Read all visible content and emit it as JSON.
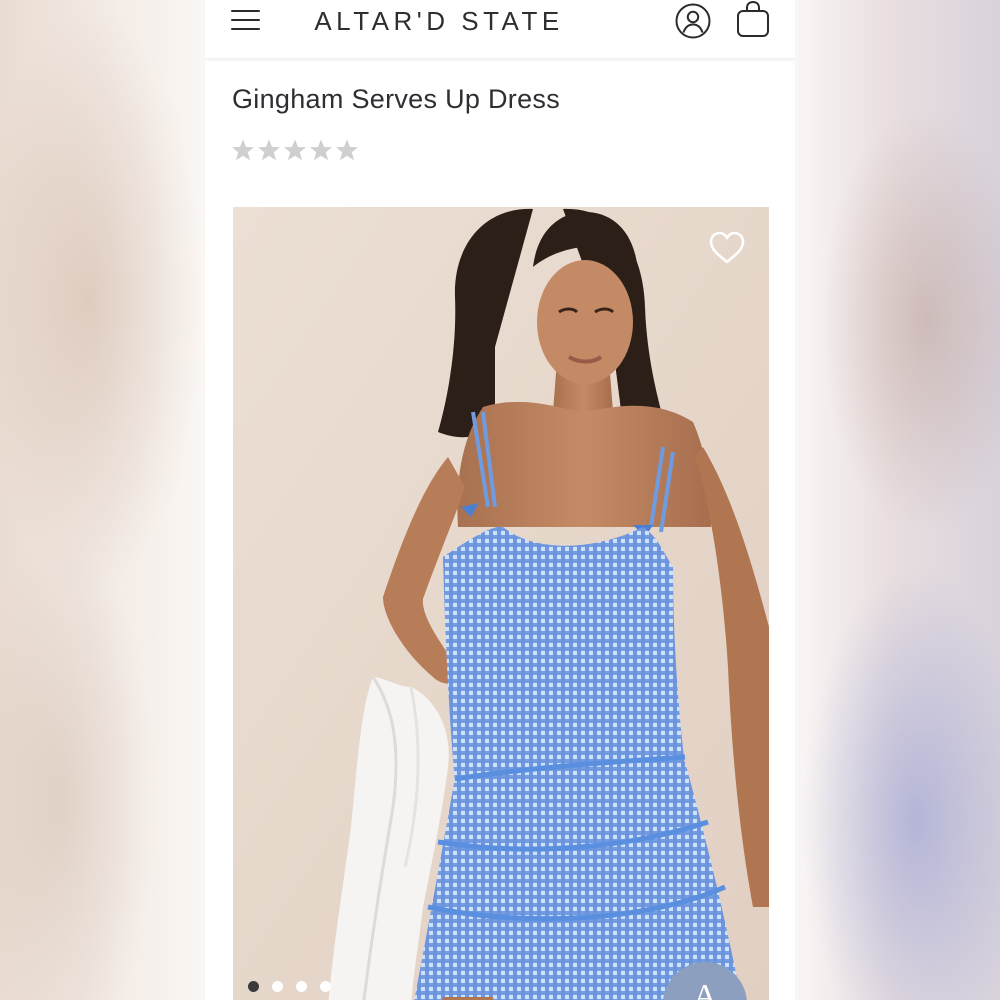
{
  "header": {
    "brand": "ALTAR'D STATE",
    "menu_icon": "hamburger-menu-icon",
    "account_icon": "user-account-icon",
    "bag_icon": "shopping-bag-icon"
  },
  "product": {
    "title": "Gingham Serves Up Dress",
    "rating": {
      "value": 0,
      "max": 5,
      "empty_star_color": "#cfcfcf"
    }
  },
  "gallery": {
    "image": "model-in-blue-gingham-dress",
    "wishlist_icon": "heart-outline-icon",
    "image_count": 4,
    "active_index": 0,
    "help_badge_glyph": "A"
  },
  "colors": {
    "text": "#2e2e33",
    "dress_blue": "#6f9be0",
    "badge": "#8c9fbe"
  }
}
